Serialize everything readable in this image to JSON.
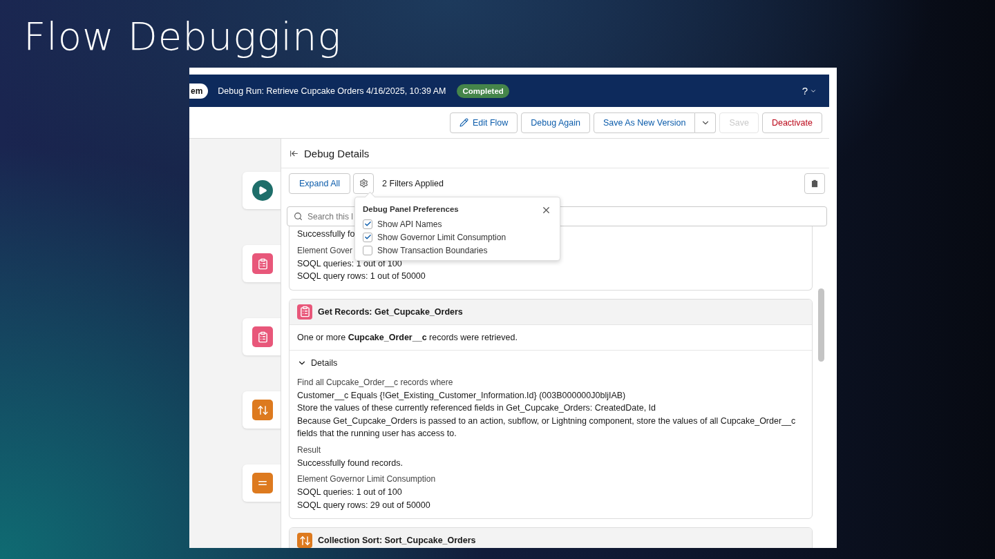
{
  "slide_title": "Flow Debugging",
  "header": {
    "badge": "em",
    "title": "Debug Run: Retrieve Cupcake Orders 4/16/2025, 10:39 AM",
    "status": "Completed",
    "help": "?"
  },
  "toolbar": {
    "buttons": [
      {
        "label": "Edit Flow",
        "kind": "icon",
        "disabled": false
      },
      {
        "label": "Debug Again",
        "kind": "plain",
        "disabled": false
      },
      {
        "label": "Save As New Version",
        "kind": "split",
        "disabled": false
      },
      {
        "label": "Save",
        "kind": "plain",
        "disabled": true
      },
      {
        "label": "Deactivate",
        "kind": "destructive",
        "disabled": false
      }
    ]
  },
  "canvas": {
    "nodes": [
      {
        "kind": "start"
      },
      {
        "kind": "get-records"
      },
      {
        "kind": "get-records"
      },
      {
        "kind": "sort"
      },
      {
        "kind": "assignment"
      }
    ]
  },
  "panel": {
    "title": "Debug Details",
    "expand_all": "Expand All",
    "filters": "2 Filters Applied",
    "search": {
      "placeholder": "Search this l"
    },
    "preferences": {
      "title": "Debug Panel Preferences",
      "options": [
        {
          "label": "Show API Names",
          "checked": true
        },
        {
          "label": "Show Governor Limit Consumption",
          "checked": true
        },
        {
          "label": "Show Transaction Boundaries",
          "checked": false
        }
      ]
    },
    "entries": [
      {
        "kind": "partial",
        "groups": [
          {
            "lines": [
              "Successfully fo"
            ]
          },
          {
            "heading": "Element Gover",
            "lines": [
              "SOQL queries: 1 out of 100",
              "SOQL query rows: 1 out of 50000"
            ]
          }
        ]
      },
      {
        "kind": "get-records",
        "title": "Get Records: Get_Cupcake_Orders",
        "summary": "One or more **Cupcake_Order__c** records were retrieved.",
        "details_label": "Details",
        "expanded": true,
        "groups": [
          {
            "heading": "Find all Cupcake_Order__c records where",
            "lines": [
              "Customer__c Equals {!Get_Existing_Customer_Information.Id} (003B000000J0bljIAB)",
              "Store the values of these currently referenced fields in Get_Cupcake_Orders: CreatedDate, Id",
              "Because Get_Cupcake_Orders is passed to an action, subflow, or Lightning component, store the values of all Cupcake_Order__c fields that the running user has access to."
            ]
          },
          {
            "heading": "Result",
            "lines": [
              "Successfully found records."
            ]
          },
          {
            "heading": "Element Governor Limit Consumption",
            "lines": [
              "SOQL queries: 1 out of 100",
              "SOQL query rows: 29 out of 50000"
            ]
          }
        ]
      },
      {
        "kind": "collection-sort",
        "title": "Collection Sort: Sort_Cupcake_Orders"
      }
    ]
  }
}
